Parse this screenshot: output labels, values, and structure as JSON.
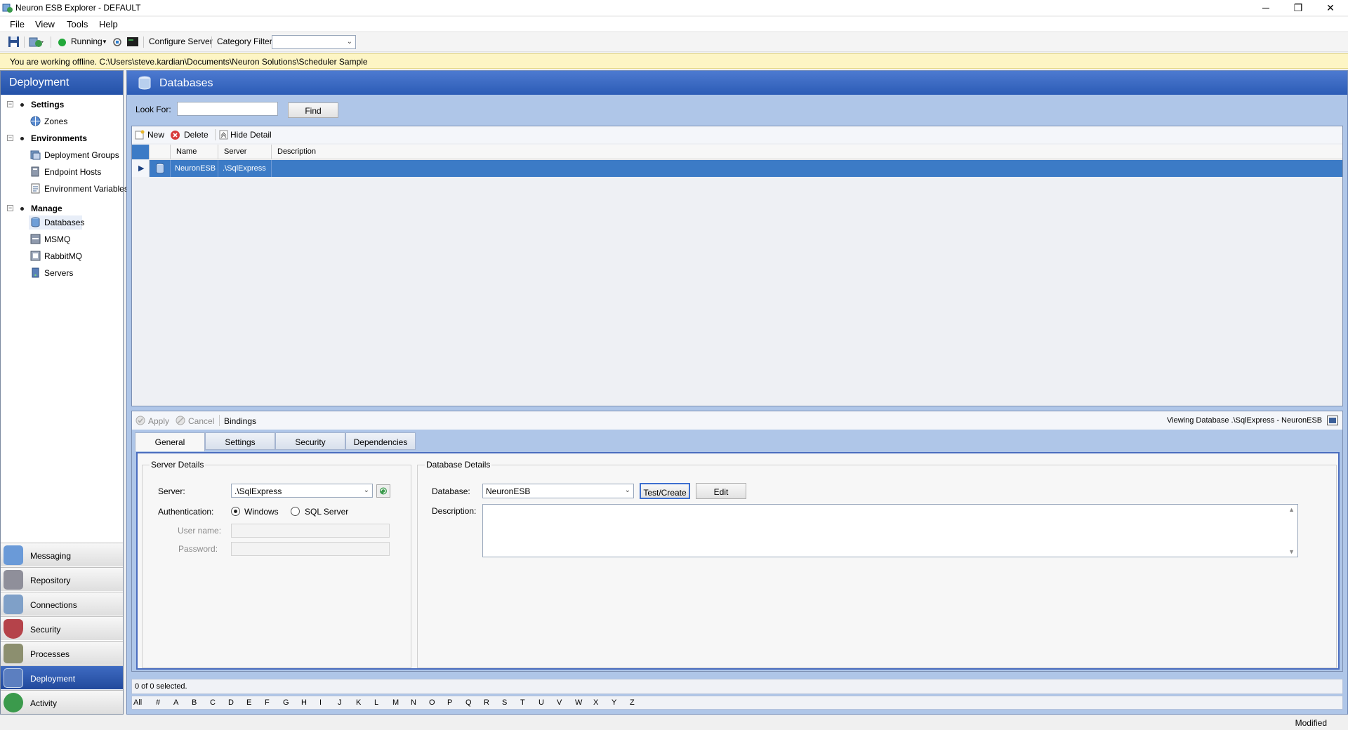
{
  "window": {
    "title": "Neuron ESB Explorer - DEFAULT",
    "minimize": "─",
    "restore": "❐",
    "close": "✕"
  },
  "menu": [
    "File",
    "View",
    "Tools",
    "Help"
  ],
  "toolbar": {
    "running_label": "Running",
    "configure_server": "Configure Server",
    "category_filter_label": "Category Filter",
    "category_filter_value": ""
  },
  "banner": {
    "text": "You are working offline. C:\\Users\\steve.kardian\\Documents\\Neuron Solutions\\Scheduler Sample"
  },
  "left_pane": {
    "title": "Deployment",
    "tree": [
      {
        "label": "Settings",
        "type": "group"
      },
      {
        "label": "Zones",
        "type": "leaf",
        "icon": "globe-icon"
      },
      {
        "label": "Environments",
        "type": "group"
      },
      {
        "label": "Deployment Groups",
        "type": "leaf",
        "icon": "deployment-group-icon"
      },
      {
        "label": "Endpoint Hosts",
        "type": "leaf",
        "icon": "endpoint-host-icon"
      },
      {
        "label": "Environment Variables",
        "type": "leaf",
        "icon": "variable-icon"
      },
      {
        "label": "Manage",
        "type": "group"
      },
      {
        "label": "Databases",
        "type": "leaf",
        "icon": "database-icon"
      },
      {
        "label": "MSMQ",
        "type": "leaf",
        "icon": "msmq-icon"
      },
      {
        "label": "RabbitMQ",
        "type": "leaf",
        "icon": "rabbitmq-icon"
      },
      {
        "label": "Servers",
        "type": "leaf",
        "icon": "server-icon"
      }
    ],
    "nav": [
      {
        "label": "Messaging",
        "icon": "messaging-icon",
        "color": "#6a9ad8"
      },
      {
        "label": "Repository",
        "icon": "repository-icon",
        "color": "#8f8f9a"
      },
      {
        "label": "Connections",
        "icon": "connections-icon",
        "color": "#7fa0c8"
      },
      {
        "label": "Security",
        "icon": "shield-icon",
        "color": "#b5434a"
      },
      {
        "label": "Processes",
        "icon": "processes-icon",
        "color": "#8c8f6f"
      },
      {
        "label": "Deployment",
        "icon": "deployment-icon",
        "color": "#5c7fc0",
        "active": true
      },
      {
        "label": "Activity",
        "icon": "activity-icon",
        "color": "#3b9a4c"
      }
    ]
  },
  "main": {
    "title": "Databases",
    "look_for_label": "Look For:",
    "look_for_value": "",
    "find_button": "Find",
    "grid_toolbar": {
      "new": "New",
      "delete": "Delete",
      "hide_detail": "Hide Detail"
    },
    "columns": [
      "Name",
      "Server",
      "Description"
    ],
    "rows": [
      {
        "name": "NeuronESB",
        "server": ".\\SqlExpress",
        "description": ""
      }
    ]
  },
  "detail": {
    "apply": "Apply",
    "cancel": "Cancel",
    "bindings": "Bindings",
    "viewing": "Viewing Database .\\SqlExpress - NeuronESB",
    "tabs": [
      "General",
      "Settings",
      "Security",
      "Dependencies"
    ],
    "server_details": {
      "legend": "Server Details",
      "server_label": "Server:",
      "server_value": ".\\SqlExpress",
      "auth_label": "Authentication:",
      "auth_windows": "Windows",
      "auth_sql": "SQL Server",
      "username_label": "User name:",
      "password_label": "Password:"
    },
    "database_details": {
      "legend": "Database Details",
      "database_label": "Database:",
      "database_value": "NeuronESB",
      "test_create": "Test/Create",
      "edit": "Edit",
      "description_label": "Description:",
      "description_value": ""
    }
  },
  "status": {
    "selection": "0 of 0 selected.",
    "alphabet": [
      "All",
      "#",
      "A",
      "B",
      "C",
      "D",
      "E",
      "F",
      "G",
      "H",
      "I",
      "J",
      "K",
      "L",
      "M",
      "N",
      "O",
      "P",
      "Q",
      "R",
      "S",
      "T",
      "U",
      "V",
      "W",
      "X",
      "Y",
      "Z"
    ],
    "bottom": "Modified"
  },
  "colors": {
    "accent": "#2c5cb6",
    "selection": "#3c7bc6",
    "banner": "#fdf5c4",
    "running": "#22a83a"
  }
}
